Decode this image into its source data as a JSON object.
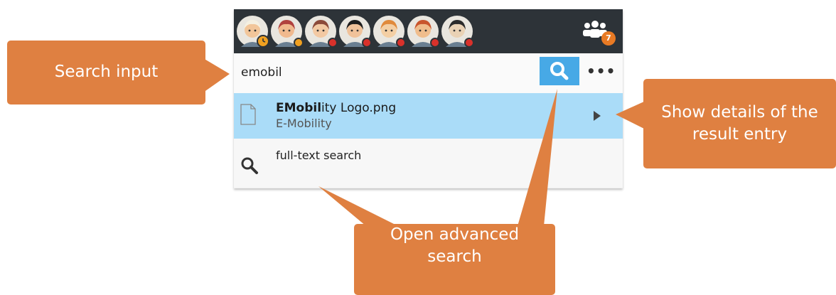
{
  "colors": {
    "topbar": "#2d3338",
    "accent_blue": "#47a9e6",
    "result_highlight": "#aadcf8",
    "callout_orange": "#df8041",
    "badge_orange": "#e87a24",
    "status_orange": "#f0a020",
    "status_red": "#d9312b"
  },
  "topbar": {
    "avatars": [
      {
        "name": "avatar-1",
        "status": "away-clock"
      },
      {
        "name": "avatar-2",
        "status": "orange"
      },
      {
        "name": "avatar-3",
        "status": "red"
      },
      {
        "name": "avatar-4",
        "status": "red"
      },
      {
        "name": "avatar-5",
        "status": "red"
      },
      {
        "name": "avatar-6",
        "status": "red"
      },
      {
        "name": "avatar-7",
        "status": "red"
      }
    ],
    "team_icon": "people-group-icon",
    "team_badge": "7"
  },
  "search": {
    "value": "emobil",
    "search_icon": "search-icon",
    "more_icon": "ellipsis-icon",
    "more_label": "•••"
  },
  "results": [
    {
      "name_match": "EMobil",
      "name_rest": "ity Logo.png",
      "location": "E-Mobility",
      "icon": "file-icon",
      "action_icon": "chevron-right-icon"
    }
  ],
  "fulltext": {
    "label": "full-text search",
    "icon": "search-icon"
  },
  "callouts": {
    "search_input": "Search input",
    "details_line1": "Show details of the",
    "details_line2": "result entry",
    "advanced_line1": "Open advanced",
    "advanced_line2": "search"
  }
}
